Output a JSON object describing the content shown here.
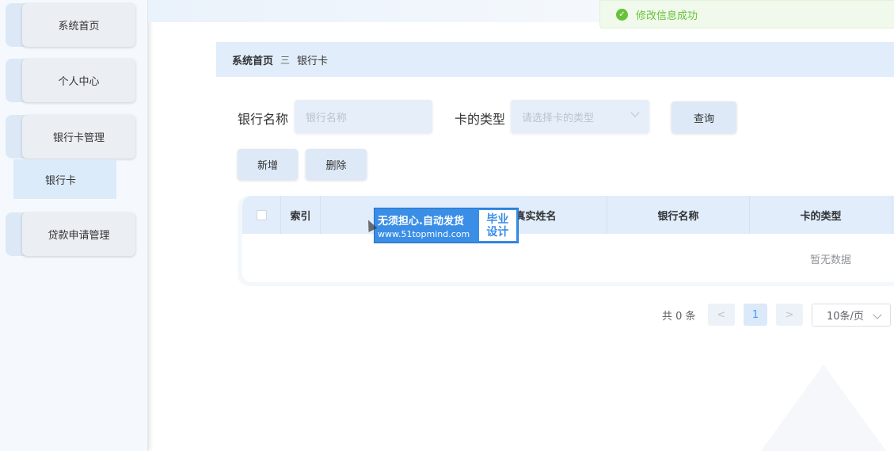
{
  "sidebar": {
    "items": [
      {
        "label": "系统首页"
      },
      {
        "label": "个人中心"
      },
      {
        "label": "银行卡管理"
      },
      {
        "label": "贷款申请管理"
      }
    ],
    "sub_item": "银行卡"
  },
  "toast": {
    "message": "修改信息成功",
    "icon": "check-circle-icon"
  },
  "breadcrumb": {
    "home": "系统首页",
    "separator": "三",
    "current": "银行卡"
  },
  "search": {
    "bank_name_label": "银行名称",
    "bank_name_placeholder": "银行名称",
    "card_type_label": "卡的类型",
    "card_type_placeholder": "请选择卡的类型",
    "query_button": "查询"
  },
  "actions": {
    "add_button": "新增",
    "delete_button": "删除"
  },
  "table": {
    "columns": [
      "索引",
      "真实姓名",
      "银行名称",
      "卡的类型"
    ],
    "empty_text": "暂无数据"
  },
  "pagination": {
    "total_text": "共 0 条",
    "prev": "<",
    "page": "1",
    "next": ">",
    "page_size": "10条/页"
  },
  "watermark": {
    "line1": "无须担心.自动发货",
    "line2": "www.51topmind.com",
    "badge_line1": "毕业",
    "badge_line2": "设计"
  },
  "colors": {
    "accent": "#409eff",
    "success": "#67c23a",
    "header_bg": "#e1edfa"
  }
}
